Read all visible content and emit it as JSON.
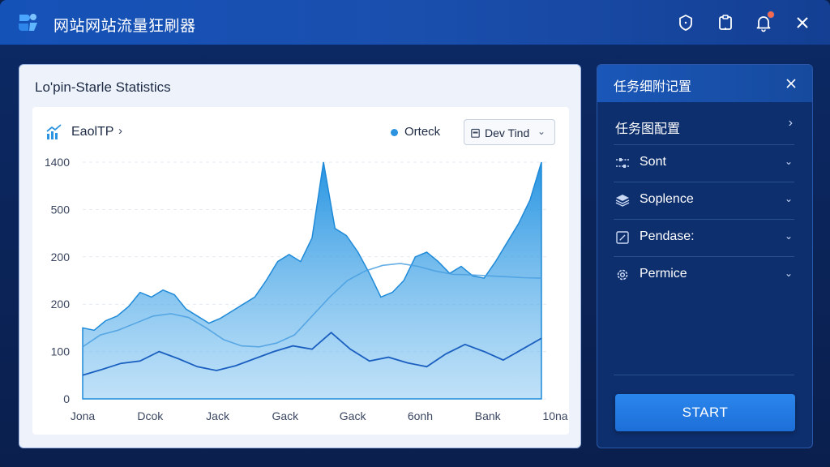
{
  "app": {
    "title": "网站网站流量狂刷器",
    "accent_color": "#1a57b8",
    "icons": [
      "logo-icon",
      "shield-icon",
      "clipboard-icon",
      "bell-icon",
      "close-icon"
    ],
    "notification_dot_color": "#f26a4f"
  },
  "stats_card": {
    "title": "Lo'pin-Starle Statistics",
    "panel": {
      "header_label": "EaolTP",
      "header_chevron": "›",
      "legend_label": "Orteck",
      "legend_color": "#2b93e0",
      "dropdown_label": "Dev Tind",
      "dropdown_chevron": "⌄"
    }
  },
  "chart_data": {
    "type": "area",
    "title": "",
    "xlabel": "",
    "ylabel": "",
    "y_tick_labels": [
      "0",
      "100",
      "200",
      "200",
      "500",
      "1400"
    ],
    "x_tick_labels": [
      "Jona",
      "Dcok",
      "Jack",
      "Gack",
      "Gack",
      "6onh",
      "Bank",
      "10na"
    ],
    "grid": true,
    "series": [
      {
        "values": [
          150,
          145,
          165,
          175,
          195,
          225,
          215,
          230,
          220,
          190,
          175,
          160,
          170,
          185,
          200,
          215,
          250,
          290,
          305,
          290,
          340,
          500,
          360,
          345,
          310,
          265,
          215,
          225,
          250,
          300,
          310,
          290,
          265,
          280,
          260,
          255,
          290,
          330,
          370,
          420,
          505
        ]
      },
      {
        "values": [
          110,
          135,
          145,
          160,
          175,
          180,
          172,
          150,
          125,
          112,
          110,
          118,
          135,
          175,
          215,
          250,
          270,
          282,
          286,
          280,
          270,
          263,
          262,
          260,
          258,
          256,
          255
        ]
      },
      {
        "values": [
          50,
          62,
          75,
          80,
          100,
          85,
          68,
          60,
          70,
          85,
          100,
          112,
          105,
          140,
          105,
          80,
          88,
          76,
          68,
          95,
          115,
          100,
          82,
          105,
          128
        ]
      }
    ]
  },
  "task_panel": {
    "title": "任务细附记置",
    "items": [
      {
        "label": "任务图配置",
        "icon": "",
        "chevron": "›"
      },
      {
        "label": "Sont",
        "icon": "sliders-icon",
        "chevron": "⌄"
      },
      {
        "label": "Soplence",
        "icon": "layers-icon",
        "chevron": "⌄"
      },
      {
        "label": "Pendase:",
        "icon": "edit-square-icon",
        "chevron": "⌄"
      },
      {
        "label": "Permice",
        "icon": "gear-icon",
        "chevron": "⌄"
      }
    ],
    "start_label": "START"
  }
}
